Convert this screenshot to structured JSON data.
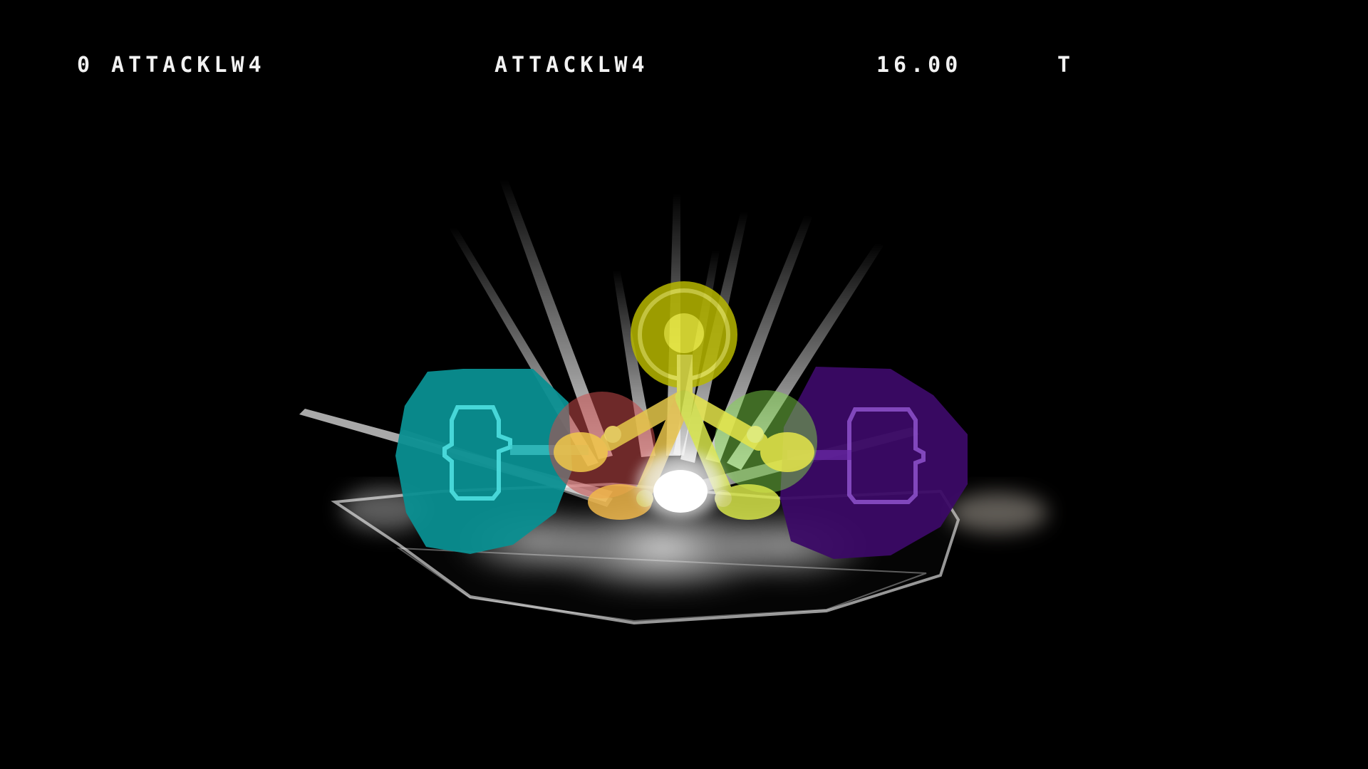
{
  "hud": {
    "left_label": "0 ATTACKLW4",
    "center_label": "ATTACKLW4",
    "timer": "16.00",
    "right_label": "T"
  },
  "scene": {
    "background_color": "#000000",
    "hitbox_colors": {
      "left": "#0a8f91",
      "right": "#3b0a66",
      "top": "#d4d40a",
      "center_left": "#c94a4a",
      "center_right": "#7fd64a",
      "core": "#e8d44a"
    },
    "icons": [
      "hitbox-left-icon",
      "hitbox-right-icon",
      "hitbox-top-icon",
      "impact-burst-icon",
      "stage-platform-icon",
      "dust-cloud-icon"
    ]
  }
}
